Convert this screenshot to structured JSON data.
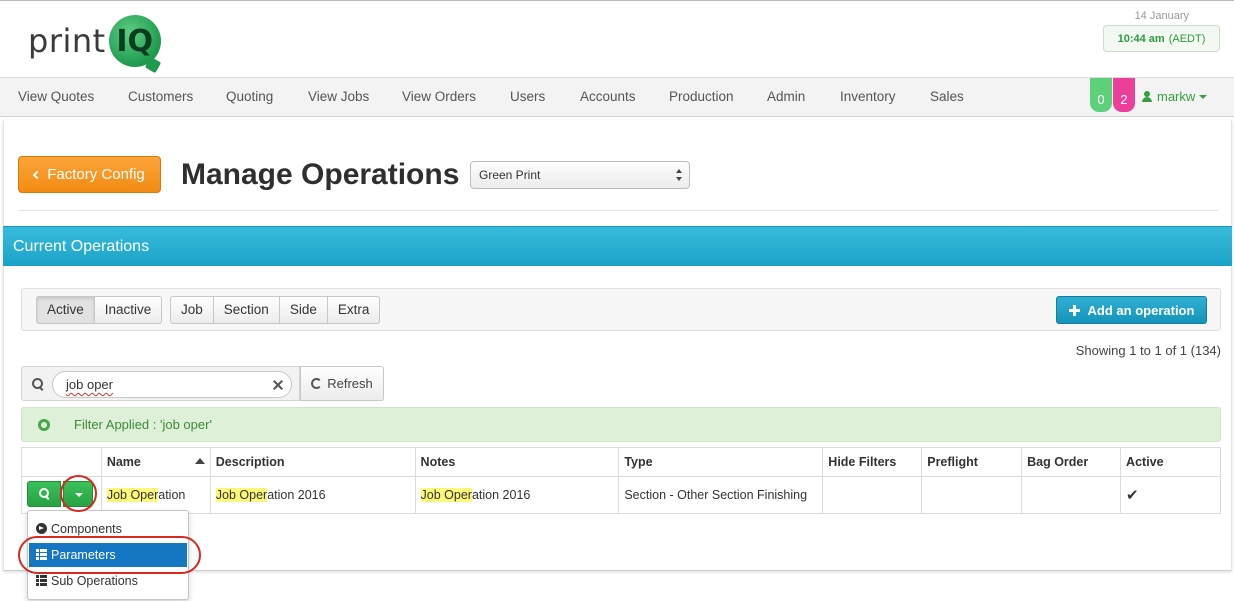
{
  "header": {
    "logo_text": "print",
    "logo_badge": "IQ",
    "date": "14 January",
    "time": "10:44 am",
    "timezone": "(AEDT)"
  },
  "nav": {
    "items": [
      "View Quotes",
      "Customers",
      "Quoting",
      "View Jobs",
      "View Orders",
      "Users",
      "Accounts",
      "Production",
      "Admin",
      "Inventory",
      "Sales"
    ],
    "badge_green": "0",
    "badge_pink": "2",
    "user": "markw"
  },
  "page": {
    "back_button": "Factory Config",
    "title": "Manage Operations",
    "factory_select": "Green Print",
    "section_title": "Current Operations"
  },
  "filters": {
    "status": [
      "Active",
      "Inactive"
    ],
    "active_status": "Active",
    "types": [
      "Job",
      "Section",
      "Side",
      "Extra"
    ],
    "add_button": "Add an operation",
    "showing": "Showing 1 to 1 of 1 (134)"
  },
  "search": {
    "value": "job oper",
    "refresh_label": "Refresh",
    "filter_applied": "Filter Applied : 'job oper'"
  },
  "table": {
    "columns": [
      "",
      "Name",
      "Description",
      "Notes",
      "Type",
      "Hide Filters",
      "Preflight",
      "Bag Order",
      "Active"
    ],
    "rows": [
      {
        "name_hl": "Job Oper",
        "name_rest": "ation",
        "description_hl": "Job Oper",
        "description_rest": "ation 2016",
        "notes_hl": "Job Oper",
        "notes_rest": "ation 2016",
        "type": "Section - Other Section Finishing",
        "hide_filters": "",
        "preflight": "",
        "bag_order": "",
        "active": "✔"
      }
    ]
  },
  "menu": {
    "items": [
      {
        "label": "Components",
        "icon": "arrow-circle-right-icon"
      },
      {
        "label": "Parameters",
        "icon": "list-icon"
      },
      {
        "label": "Sub Operations",
        "icon": "list-icon"
      }
    ],
    "highlighted": "Parameters"
  },
  "colors": {
    "brand_green": "#1d9a4e",
    "accent_orange": "#f38b13",
    "section_blue": "#1aa3c7",
    "menu_active": "#1576c2",
    "annotation_red": "#d42a22"
  }
}
